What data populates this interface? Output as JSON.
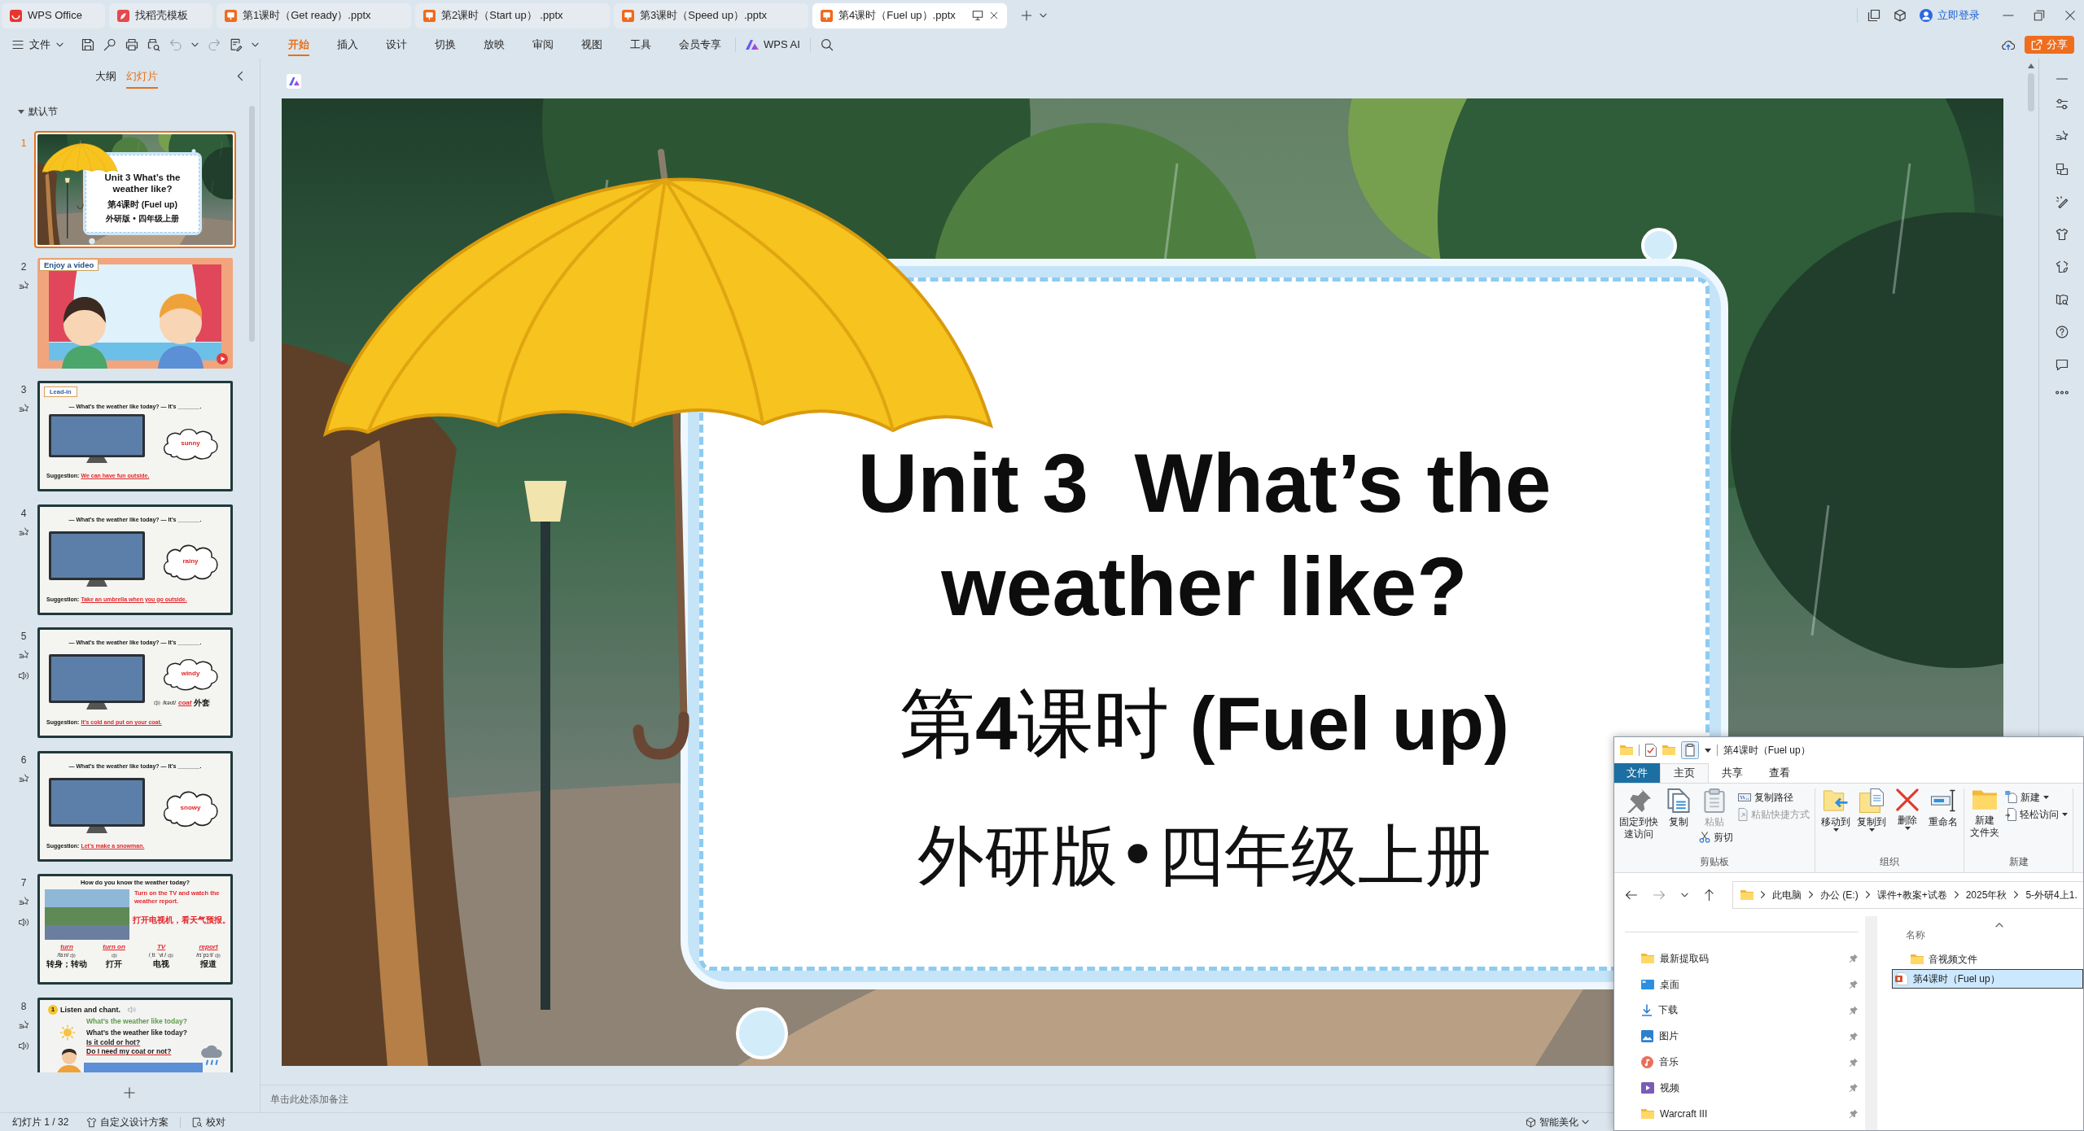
{
  "tabs": [
    {
      "label": "WPS Office",
      "kind": "wps",
      "selected": false
    },
    {
      "label": "找稻壳模板",
      "kind": "template",
      "selected": false
    },
    {
      "label": "第1课时（Get ready）.pptx",
      "kind": "slides",
      "selected": false
    },
    {
      "label": "第2课时（Start up） .pptx",
      "kind": "slides",
      "selected": false
    },
    {
      "label": "第3课时（Speed up）.pptx",
      "kind": "slides",
      "selected": false
    },
    {
      "label": "第4课时（Fuel up）.pptx",
      "kind": "slides",
      "selected": true
    }
  ],
  "account": {
    "login": "立即登录"
  },
  "toolbar": {
    "file": "文件",
    "tabs": [
      {
        "label": "开始",
        "selected": true
      },
      {
        "label": "插入",
        "selected": false
      },
      {
        "label": "设计",
        "selected": false
      },
      {
        "label": "切换",
        "selected": false
      },
      {
        "label": "放映",
        "selected": false
      },
      {
        "label": "审阅",
        "selected": false
      },
      {
        "label": "视图",
        "selected": false
      },
      {
        "label": "工具",
        "selected": false
      },
      {
        "label": "会员专享",
        "selected": false
      }
    ],
    "ai": "WPS AI",
    "share": "分享"
  },
  "panel": {
    "tabs": [
      {
        "label": "大纲",
        "selected": false
      },
      {
        "label": "幻灯片",
        "selected": true
      }
    ],
    "section": "默认节",
    "slides": [
      {
        "number": "1",
        "selected": true,
        "animated": false,
        "audio": false,
        "kind": "title",
        "lines": [
          "Unit 3 What’s the",
          "weather like?"
        ],
        "lesson": "第4课时 (Fuel up)",
        "edition": "外研版 • 四年级上册"
      },
      {
        "number": "2",
        "selected": false,
        "animated": true,
        "audio": false,
        "kind": "video",
        "tag": "Enjoy a video"
      },
      {
        "number": "3",
        "selected": false,
        "animated": true,
        "audio": false,
        "kind": "weather",
        "tag": "Lead-in",
        "question": "— What’s the weather like today? — It’s _______.",
        "answer": "sunny",
        "label": "Suggestion:",
        "suggestion": "We can have fun outside."
      },
      {
        "number": "4",
        "selected": false,
        "animated": true,
        "audio": false,
        "kind": "weather",
        "question": "— What’s the weather like today? — It’s _______.",
        "answer": "rainy",
        "label": "Suggestion:",
        "suggestion": "Take an umbrella when you go outside."
      },
      {
        "number": "5",
        "selected": false,
        "animated": true,
        "audio": true,
        "kind": "weather",
        "question": "— What’s the weather like today? — It’s _______.",
        "answer": "windy",
        "word": {
          "phonetic": "/kəʊt/",
          "word": "coat",
          "meaning": "外套"
        },
        "label": "Suggestion:",
        "suggestion": "It’s cold and put on your coat."
      },
      {
        "number": "6",
        "selected": false,
        "animated": true,
        "audio": false,
        "kind": "weather",
        "question": "— What’s the weather like today? — It’s _______.",
        "answer": "snowy",
        "label": "Suggestion:",
        "suggestion": "Let’s make a snowman."
      },
      {
        "number": "7",
        "selected": false,
        "animated": true,
        "audio": true,
        "kind": "words",
        "question": "How do you know the weather today?",
        "phrase": "Turn on the TV and watch the weather report.",
        "translation": "打开电视机，看天气预报。",
        "words": [
          {
            "word": "turn",
            "phonetic": "/tɜːn/",
            "meaning": "转身；转动"
          },
          {
            "word": "turn on",
            "meaning": "打开"
          },
          {
            "word": "TV",
            "phonetic": "/ˌtiː ˈviː/",
            "meaning": "电视"
          },
          {
            "word": "report",
            "phonetic": "/rɪˈpɔːt/",
            "meaning": "报道"
          }
        ]
      },
      {
        "number": "8",
        "selected": false,
        "animated": true,
        "audio": true,
        "kind": "chant",
        "badge": "1",
        "heading": "Listen and chant.",
        "lines": [
          {
            "text": "What’s the weather like today?",
            "color": "#5e9a4a",
            "underlined": false
          },
          {
            "text": "What’s the weather like today?",
            "color": "#1a1a1a",
            "underlined": false
          },
          {
            "text": "Is it cold or hot?",
            "color": "#1a1a1a",
            "underlined": true
          },
          {
            "text": "Do I need my coat or not?",
            "color": "#1a1a1a",
            "underlined": true
          }
        ]
      }
    ]
  },
  "slide": {
    "title_lines": [
      "Unit 3  What’s the",
      "weather like?"
    ],
    "lesson": "第**4**课时 **(Fuel up)**",
    "edition": "外研版•四年级上册"
  },
  "notes": {
    "placeholder": "单击此处添加备注"
  },
  "status_bar": {
    "slide_counter": "幻灯片 1 / 32",
    "design": "自定义设计方案",
    "proofread": "校对",
    "beautify": "智能美化"
  },
  "explorer": {
    "title": "第4课时（Fuel up）",
    "tabs": [
      {
        "label": "文件",
        "kind": "file",
        "selected": false
      },
      {
        "label": "主页",
        "kind": "tab",
        "selected": true
      },
      {
        "label": "共享",
        "kind": "tab",
        "selected": false
      },
      {
        "label": "查看",
        "kind": "tab",
        "selected": false
      }
    ],
    "groups": [
      {
        "label": "剪贴板",
        "items": [
          {
            "kind": "large",
            "lines": [
              "固定到快",
              "速访问"
            ],
            "disabled": false,
            "dropdown": false
          },
          {
            "kind": "large",
            "lines": [
              "复制"
            ],
            "disabled": false,
            "dropdown": false
          },
          {
            "kind": "large",
            "lines": [
              "粘贴"
            ],
            "disabled": true,
            "dropdown": false
          },
          {
            "kind": "stacked",
            "lines": [
              "剪切"
            ],
            "disabled": false,
            "dropdown": false
          },
          {
            "kind": "small",
            "lines": [
              "复制路径"
            ],
            "disabled": false,
            "dropdown": false
          },
          {
            "kind": "small",
            "lines": [
              "粘贴快捷方式"
            ],
            "disabled": true,
            "dropdown": false
          }
        ]
      },
      {
        "label": "组织",
        "items": [
          {
            "kind": "large",
            "lines": [
              "移动到"
            ],
            "disabled": false,
            "dropdown": true
          },
          {
            "kind": "large",
            "lines": [
              "复制到"
            ],
            "disabled": false,
            "dropdown": true
          },
          {
            "kind": "large",
            "lines": [
              "删除"
            ],
            "disabled": false,
            "dropdown": true
          },
          {
            "kind": "large",
            "lines": [
              "重命名"
            ],
            "disabled": false,
            "dropdown": false
          }
        ]
      },
      {
        "label": "新建",
        "items": [
          {
            "kind": "large",
            "lines": [
              "新建",
              "文件夹"
            ],
            "disabled": false,
            "dropdown": false
          },
          {
            "kind": "small",
            "lines": [
              "新建"
            ],
            "disabled": false,
            "dropdown": true
          },
          {
            "kind": "small",
            "lines": [
              "轻松访问"
            ],
            "disabled": false,
            "dropdown": true
          }
        ]
      }
    ],
    "path": [
      "此电脑",
      "办公 (E:)",
      "课件+教案+试卷",
      "2025年秋",
      "5-外研4上1."
    ],
    "nav": [
      {
        "label": "最新提取码",
        "pinned": true
      },
      {
        "label": "桌面",
        "pinned": true
      },
      {
        "label": "下载",
        "pinned": true
      },
      {
        "label": "图片",
        "pinned": true
      },
      {
        "label": "音乐",
        "pinned": true
      },
      {
        "label": "视频",
        "pinned": true
      },
      {
        "label": "Warcraft III",
        "pinned": true
      }
    ],
    "column": "名称",
    "files": [
      {
        "label": "音视频文件",
        "kind": "folder",
        "selected": false
      },
      {
        "label": "第4课时（Fuel up）",
        "kind": "pptx",
        "selected": true
      }
    ]
  }
}
